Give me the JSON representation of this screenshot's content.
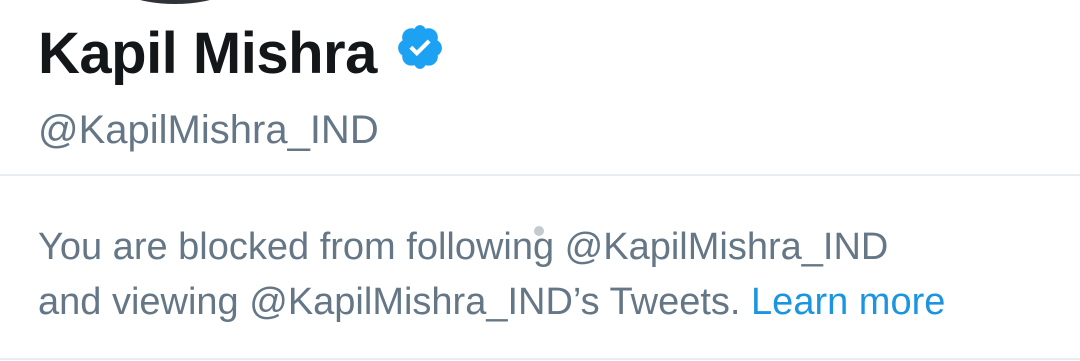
{
  "profile": {
    "display_name": "Kapil Mishra",
    "handle": "@KapilMishra_IND",
    "verified_icon": "verified-badge-icon"
  },
  "blocked_notice": {
    "line1": "You are blocked from following @KapilMishra_IND",
    "line2": "and viewing @KapilMishra_IND’s Tweets.",
    "learn_more_label": "Learn more"
  },
  "colors": {
    "name": "#14171a",
    "secondary_text": "#657786",
    "link": "#1b95e0",
    "verified": "#1da1f2",
    "divider": "#e6ecf0"
  }
}
